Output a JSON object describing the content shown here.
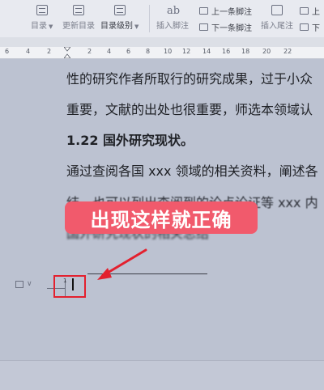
{
  "ribbon": {
    "toc_label": "目录",
    "update_toc_label": "更新目录",
    "toc_level_label": "目录级别",
    "insert_footnote_label": "插入脚注",
    "prev_footnote_label": "上一条脚注",
    "next_footnote_label": "下一条脚注",
    "insert_endnote_label": "插入尾注",
    "ab_glyph": "ab",
    "right_cut_top": "上",
    "right_cut_bottom": "下"
  },
  "ruler": {
    "numbers": [
      "6",
      "4",
      "2",
      "2",
      "4",
      "6",
      "8",
      "10",
      "12",
      "14",
      "16",
      "18",
      "20",
      "22"
    ]
  },
  "document": {
    "line1": "性的研究作者所取行的研究成果，过于小众",
    "line2": "重要，文献的出处也很重要，师选本领域认",
    "heading": "1.22 国外研究现状。",
    "line3": "通过查阅各国 xxx 领域的相关资料，阐述各",
    "line4": "结，也可以列出查阅到的论点论证等 xxx 内",
    "line5": "国外研究现状的相关总结",
    "footnote_number": "1"
  },
  "annotation": {
    "banner_text": "出现这样就正确",
    "accent_color": "#f15a6c",
    "box_color": "#e3202e"
  }
}
